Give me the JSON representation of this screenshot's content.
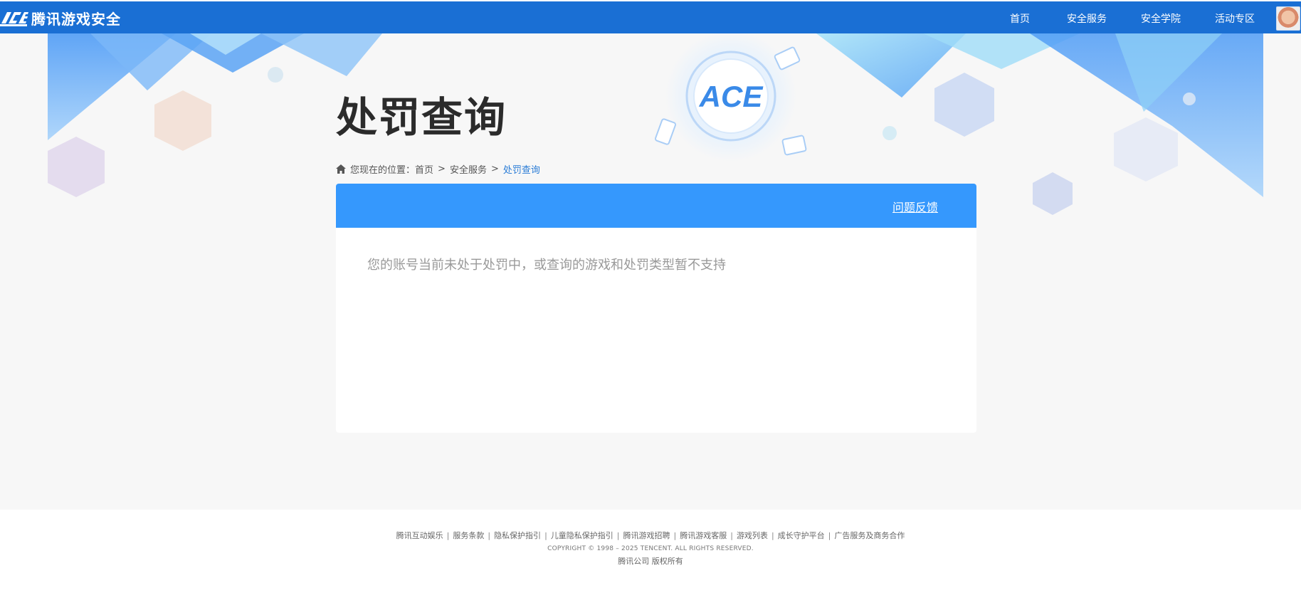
{
  "header": {
    "logo_text": "腾讯游戏安全",
    "nav": [
      "首页",
      "安全服务",
      "安全学院",
      "活动专区"
    ],
    "brand_color": "#1a6fd4"
  },
  "banner": {
    "emblem_text": "ACE",
    "page_title": "处罚查询"
  },
  "breadcrumb": {
    "prefix": "您现在的位置：",
    "items": [
      "首页",
      "安全服务",
      "处罚查询"
    ],
    "separator": ">"
  },
  "card": {
    "feedback_link": "问题反馈",
    "status_message": "您的账号当前未处于处罚中，或查询的游戏和处罚类型暂不支持",
    "header_color": "#3598fd"
  },
  "footer": {
    "links": [
      "腾讯互动娱乐",
      "服务条款",
      "隐私保护指引",
      "儿童隐私保护指引",
      "腾讯游戏招聘",
      "腾讯游戏客服",
      "游戏列表",
      "成长守护平台",
      "广告服务及商务合作"
    ],
    "copyright": "COPYRIGHT © 1998 – 2025 TENCENT. ALL RIGHTS RESERVED.",
    "company": "腾讯公司 版权所有"
  }
}
